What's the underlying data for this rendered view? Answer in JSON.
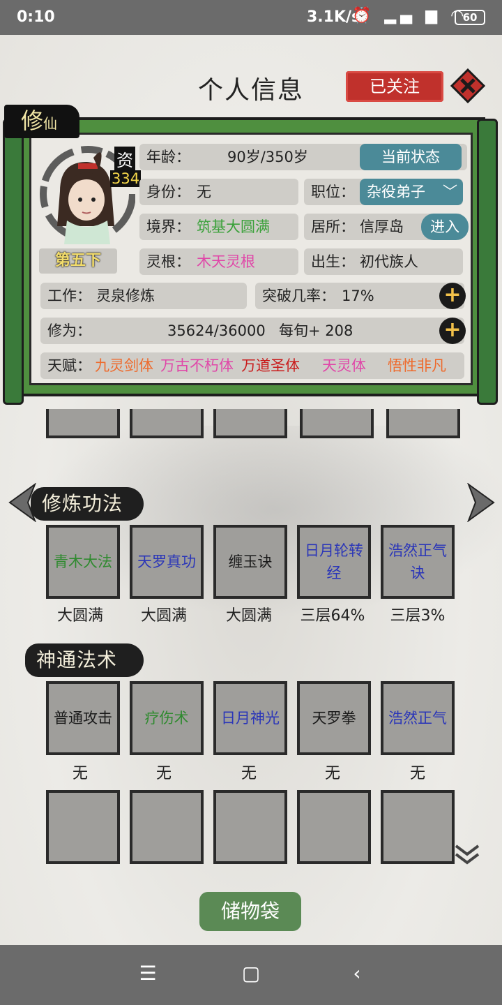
{
  "status_bar": {
    "time": "0:10",
    "network": "3.1K/s",
    "battery": "60"
  },
  "header": {
    "title": "个人信息",
    "follow_label": "已关注"
  },
  "profile": {
    "tag_main": "修",
    "tag_sub": "仙",
    "aptitude_label": "资",
    "aptitude_value": "334",
    "rank": "第五下",
    "age_label": "年龄：",
    "age_value": "90岁/350岁",
    "status_button": "当前状态",
    "identity_label": "身份：",
    "identity_value": "无",
    "position_label": "职位：",
    "position_value": "杂役弟子",
    "realm_label": "境界：",
    "realm_value": "筑基大圆满",
    "residence_label": "居所：",
    "residence_value": "信厚岛",
    "enter_button": "进入",
    "root_label": "灵根：",
    "root_value": "木天灵根",
    "birth_label": "出生：",
    "birth_value": "初代族人",
    "work_label": "工作：",
    "work_value": "灵泉修炼",
    "breakthrough_label": "突破几率：",
    "breakthrough_value": "17%",
    "cultivation_label": "修为：",
    "cultivation_value": "35624/36000",
    "cultivation_rate": "每旬+ 208",
    "talent_label": "天赋：",
    "talents": [
      "九灵剑体",
      "万古不朽体",
      "万道圣体",
      "天灵体",
      "悟性非凡"
    ]
  },
  "techniques": {
    "title": "修炼功法",
    "items": [
      {
        "name": "青木大法",
        "progress": "大圆满",
        "color": "#2f8a2f"
      },
      {
        "name": "天罗真功",
        "progress": "大圆满",
        "color": "#2a35b8"
      },
      {
        "name": "缠玉诀",
        "progress": "大圆满",
        "color": "#1a1a1a"
      },
      {
        "name": "日月轮转经",
        "progress": "三层64%",
        "color": "#2a35b8"
      },
      {
        "name": "浩然正气诀",
        "progress": "三层3%",
        "color": "#2a35b8"
      }
    ]
  },
  "skills": {
    "title": "神通法术",
    "items": [
      {
        "name": "普通攻击",
        "level": "无",
        "color": "#1a1a1a"
      },
      {
        "name": "疗伤术",
        "level": "无",
        "color": "#2f8a2f"
      },
      {
        "name": "日月神光",
        "level": "无",
        "color": "#2a35b8"
      },
      {
        "name": "天罗拳",
        "level": "无",
        "color": "#1a1a1a"
      },
      {
        "name": "浩然正气",
        "level": "无",
        "color": "#2a35b8"
      }
    ]
  },
  "footer": {
    "storage_button": "储物袋"
  }
}
